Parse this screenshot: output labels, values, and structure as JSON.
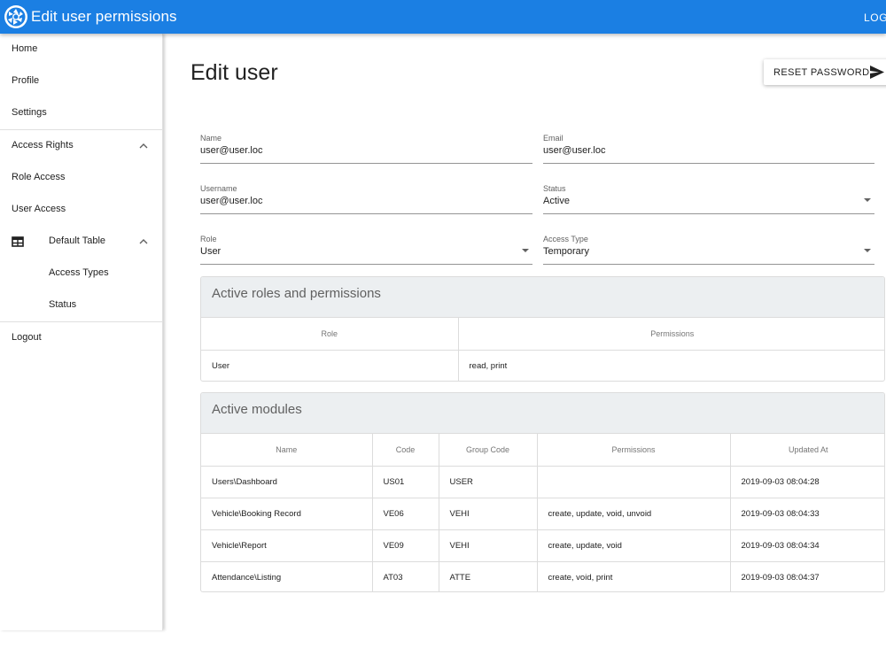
{
  "appbar": {
    "title": "Edit user permissions",
    "logout": "LOGOUT",
    "logo_icon": "aperture-logo-icon",
    "color": "#1b7fe3"
  },
  "sidebar": {
    "items": [
      {
        "label": "Home"
      },
      {
        "label": "Profile"
      },
      {
        "label": "Settings"
      },
      {
        "label": "Access Rights",
        "icon": "chevron-up-icon"
      },
      {
        "label": "Role Access"
      },
      {
        "label": "User Access"
      },
      {
        "label": "Default Table",
        "icon": "table-icon",
        "trailing_icon": "chevron-up-icon"
      },
      {
        "label": "Access Types"
      },
      {
        "label": "Status"
      },
      {
        "label": "Logout"
      }
    ]
  },
  "main": {
    "title": "Edit user",
    "reset_button": {
      "label": "RESET PASSWORD",
      "icon": "send-icon"
    },
    "form": {
      "name": {
        "label": "Name",
        "value": "user@user.loc"
      },
      "email": {
        "label": "Email",
        "value": "user@user.loc"
      },
      "username": {
        "label": "Username",
        "value": "user@user.loc"
      },
      "status": {
        "label": "Status",
        "value": "Active"
      },
      "role": {
        "label": "Role",
        "value": "User"
      },
      "access_type": {
        "label": "Access Type",
        "value": "Temporary"
      }
    },
    "roles_panel": {
      "title": "Active roles and permissions",
      "headers": [
        "Role",
        "Permissions"
      ],
      "rows": [
        [
          "User",
          "read, print"
        ]
      ]
    },
    "modules_panel": {
      "title": "Active modules",
      "headers": [
        "Name",
        "Code",
        "Group Code",
        "Permissions",
        "Updated At"
      ],
      "rows": [
        [
          "Users\\Dashboard",
          "US01",
          "USER",
          "",
          "2019-09-03 08:04:28"
        ],
        [
          "Vehicle\\Booking Record",
          "VE06",
          "VEHI",
          "create, update, void, unvoid",
          "2019-09-03 08:04:33"
        ],
        [
          "Vehicle\\Report",
          "VE09",
          "VEHI",
          "create, update, void",
          "2019-09-03 08:04:34"
        ],
        [
          "Attendance\\Listing",
          "AT03",
          "ATTE",
          "create, void, print",
          "2019-09-03 08:04:37"
        ]
      ]
    }
  }
}
